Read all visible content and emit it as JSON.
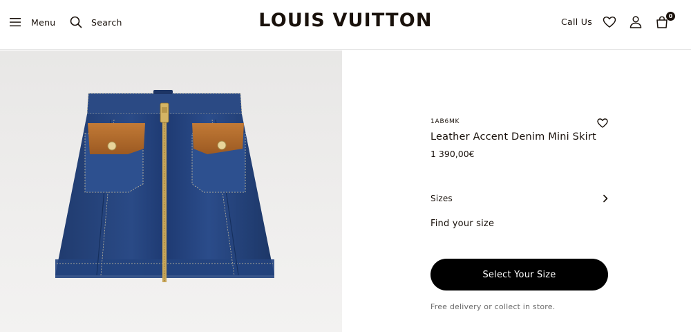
{
  "header": {
    "menu_label": "Menu",
    "search_label": "Search",
    "logo_text": "LOUIS VUITTON",
    "call_us_label": "Call Us",
    "bag_count": "0",
    "icons": [
      "menu-icon",
      "search-icon",
      "heart-icon",
      "account-icon",
      "bag-icon"
    ]
  },
  "product": {
    "sku": "1AB6MK",
    "name": "Leather Accent Denim Mini Skirt",
    "price": "1 390,00€",
    "sizes_label": "Sizes",
    "find_size_label": "Find your size",
    "select_size_label": "Select Your Size",
    "delivery_text": "Free delivery or collect in store."
  },
  "colors": {
    "text": "#19110b",
    "button_bg": "#000000",
    "button_text": "#ffffff",
    "image_bg": "#ecebea",
    "denim": "#1f3f78",
    "leather": "#b06a2b"
  }
}
